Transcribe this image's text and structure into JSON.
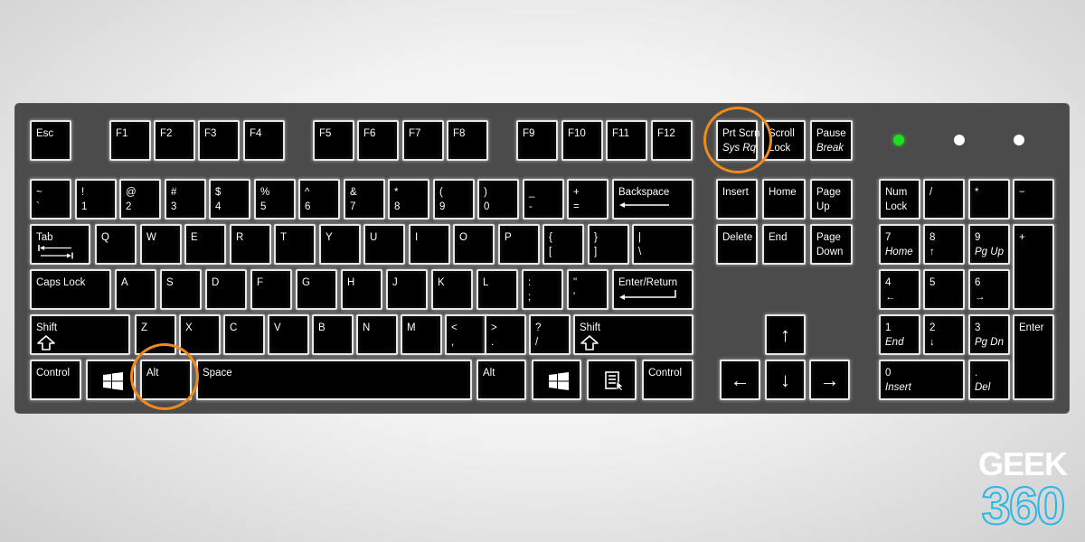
{
  "keyboard": {
    "function_row": {
      "esc": "Esc",
      "f": [
        "F1",
        "F2",
        "F3",
        "F4",
        "F5",
        "F6",
        "F7",
        "F8",
        "F9",
        "F10",
        "F11",
        "F12"
      ],
      "prtscn": {
        "top": "Prt Scrn",
        "bottom": "Sys Rq"
      },
      "scroll": {
        "top": "Scroll",
        "bottom": "Lock"
      },
      "pause": {
        "top": "Pause",
        "bottom": "Break"
      }
    },
    "number_row": [
      {
        "top": "~",
        "bottom": "`"
      },
      {
        "top": "!",
        "bottom": "1"
      },
      {
        "top": "@",
        "bottom": "2"
      },
      {
        "top": "#",
        "bottom": "3"
      },
      {
        "top": "$",
        "bottom": "4"
      },
      {
        "top": "%",
        "bottom": "5"
      },
      {
        "top": "^",
        "bottom": "6"
      },
      {
        "top": "&",
        "bottom": "7"
      },
      {
        "top": "*",
        "bottom": "8"
      },
      {
        "top": "(",
        "bottom": "9"
      },
      {
        "top": ")",
        "bottom": "0"
      },
      {
        "top": "_",
        "bottom": "-"
      },
      {
        "top": "+",
        "bottom": "="
      }
    ],
    "backspace": "Backspace",
    "tab": "Tab",
    "q_row": [
      "Q",
      "W",
      "E",
      "R",
      "T",
      "Y",
      "U",
      "I",
      "O",
      "P"
    ],
    "q_row_symbols": [
      {
        "top": "{",
        "bottom": "["
      },
      {
        "top": "}",
        "bottom": "]"
      },
      {
        "top": "|",
        "bottom": "\\"
      }
    ],
    "caps_lock": "Caps Lock",
    "a_row": [
      "A",
      "S",
      "D",
      "F",
      "G",
      "H",
      "J",
      "K",
      "L"
    ],
    "a_row_symbols": [
      {
        "top": ":",
        "bottom": ";"
      },
      {
        "top": "\"",
        "bottom": "'"
      }
    ],
    "enter_return": "Enter/Return",
    "shift_left": "Shift",
    "z_row": [
      "Z",
      "X",
      "C",
      "V",
      "B",
      "N",
      "M"
    ],
    "z_row_symbols": [
      {
        "top": "<",
        "bottom": ","
      },
      {
        "top": ">",
        "bottom": "."
      },
      {
        "top": "?",
        "bottom": "/"
      }
    ],
    "shift_right": "Shift",
    "bottom_row": {
      "control_left": "Control",
      "alt_left": "Alt",
      "space": "Space",
      "alt_right": "Alt",
      "control_right": "Control"
    },
    "nav": {
      "insert": "Insert",
      "home": "Home",
      "page_up": {
        "top": "Page",
        "bottom": "Up"
      },
      "delete": "Delete",
      "end": "End",
      "page_down": {
        "top": "Page",
        "bottom": "Down"
      },
      "arrow_up": "↑",
      "arrow_left": "←",
      "arrow_down": "↓",
      "arrow_right": "→"
    },
    "numpad": {
      "numlock": {
        "top": "Num",
        "bottom": "Lock"
      },
      "divide": "/",
      "multiply": "*",
      "minus": "−",
      "plus": "+",
      "enter": "Enter",
      "n7": {
        "top": "7",
        "bottom": "Home"
      },
      "n8": {
        "top": "8",
        "bottom": "↑"
      },
      "n9": {
        "top": "9",
        "bottom": "Pg Up"
      },
      "n4": {
        "top": "4",
        "bottom": "←"
      },
      "n5": {
        "top": "5",
        "bottom": ""
      },
      "n6": {
        "top": "6",
        "bottom": "→"
      },
      "n1": {
        "top": "1",
        "bottom": "End"
      },
      "n2": {
        "top": "2",
        "bottom": "↓"
      },
      "n3": {
        "top": "3",
        "bottom": "Pg Dn"
      },
      "n0": {
        "top": "0",
        "bottom": "Insert"
      },
      "decimal": {
        "top": ".",
        "bottom": "Del"
      }
    },
    "leds": [
      {
        "name": "num-lock-led",
        "color": "#22dd22",
        "on": true
      },
      {
        "name": "caps-lock-led",
        "color": "#ffffff",
        "on": false
      },
      {
        "name": "scroll-lock-led",
        "color": "#ffffff",
        "on": false
      }
    ],
    "highlighted_keys": [
      "Prt Scrn / Sys Rq",
      "Alt (left)"
    ],
    "highlight_color": "#f08a1c"
  },
  "logo": {
    "line1": "GEEK",
    "line2": "360",
    "accent": "#29b6e8"
  }
}
